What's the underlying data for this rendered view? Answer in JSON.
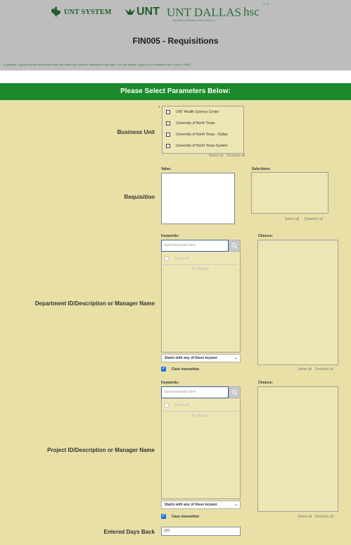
{
  "header": {
    "logos": {
      "unt_system": "UNT SYSTEM",
      "unt": "UNT",
      "unt_dallas": "UNT DALLAS",
      "unt_dallas_sub": "UNIVERSITY OF NORTH TEXAS AT DALLAS",
      "hsc": "hsc"
    },
    "title": "FIN005 - Requisitions",
    "info": "In general, Cognos reports are sourced from the Data mart, which is refreshed every night. You can expect Cognos to be available from 12AM to 9PM."
  },
  "params_title": "Please Select Parameters Below:",
  "business_unit": {
    "label": "Business Unit",
    "required_marker": "*",
    "options": [
      "UNT Health Science Center",
      "University of North Texas",
      "University of North Texas - Dallas",
      "University of North Texas System"
    ],
    "select_all": "Select all",
    "deselect_all": "Deselect all"
  },
  "requisition": {
    "label": "Requisition",
    "value_label": "Value:",
    "selections_label": "Selections:",
    "select_all": "Select all",
    "deselect_all": "Deselect all"
  },
  "department": {
    "label": "Department ID/Description or Manager Name",
    "keywords_label": "Keywords:",
    "keywords_placeholder": "Input keywords here",
    "choices_label": "Choices:",
    "select_all_check": "Select all",
    "no_results": "No Results",
    "match_mode": "Starts with any of these keywor",
    "case_insensitive": "Case insensitive",
    "select_all": "Select all",
    "deselect_all": "Deselect all"
  },
  "project": {
    "label": "Project ID/Description or Manager Name",
    "keywords_label": "Keywords:",
    "keywords_placeholder": "Input keywords here",
    "choices_label": "Choices:",
    "select_all_check": "Select all",
    "no_results": "No Results",
    "match_mode": "Starts with any of these keywor",
    "case_insensitive": "Case insensitive",
    "select_all": "Select all",
    "deselect_all": "Deselect all"
  },
  "entered_days_back": {
    "label": "Entered Days Back",
    "value": "365"
  },
  "colors": {
    "header_gray": "#bdbdbd",
    "params_green": "#1a8a2a",
    "panel_tan": "#e8e0a6",
    "brand_green": "#1a5e2a"
  }
}
